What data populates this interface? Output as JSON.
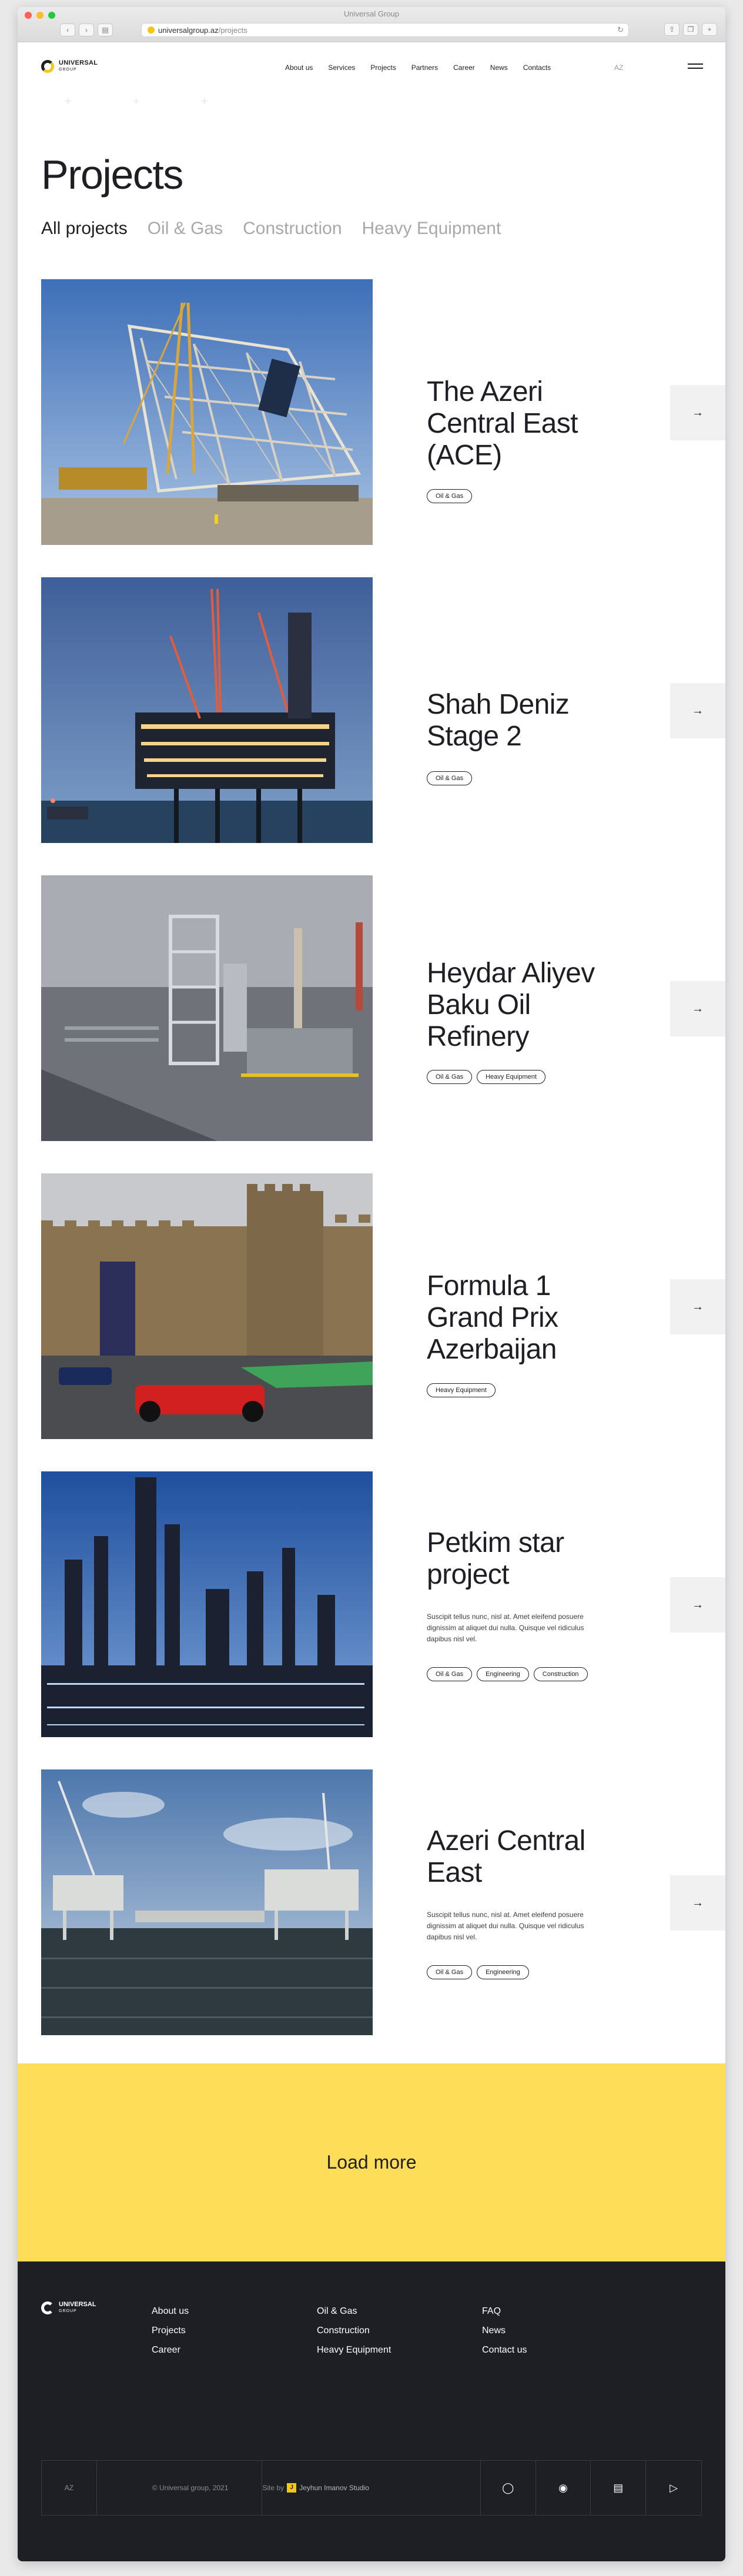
{
  "browser": {
    "window_title": "Universal Group",
    "url_domain": "universalgroup.az",
    "url_path": "/projects"
  },
  "header": {
    "logo_main": "UNIVERSAL",
    "logo_sub": "GROUP",
    "nav": [
      "About us",
      "Services",
      "Projects",
      "Partners",
      "Career",
      "News",
      "Contacts"
    ],
    "lang": "AZ"
  },
  "page": {
    "title": "Projects",
    "filters": [
      "All projects",
      "Oil & Gas",
      "Construction",
      "Heavy Equipment"
    ],
    "active_filter": "All projects"
  },
  "projects": [
    {
      "name": "The Azeri Central East (ACE)",
      "description": "",
      "tags": [
        "Oil & Gas"
      ],
      "image": "offshore-jacket-construction-yard"
    },
    {
      "name": "Shah Deniz Stage 2",
      "description": "",
      "tags": [
        "Oil & Gas"
      ],
      "image": "offshore-platform-at-dusk"
    },
    {
      "name": "Heydar Aliyev Baku Oil Refinery",
      "description": "",
      "tags": [
        "Oil & Gas",
        "Heavy Equipment"
      ],
      "image": "oil-refinery-aerial"
    },
    {
      "name": "Formula 1 Grand Prix Azerbaijan",
      "description": "",
      "tags": [
        "Heavy Equipment"
      ],
      "image": "f1-car-old-city-wall"
    },
    {
      "name": "Petkim star project",
      "description": "Suscipit tellus nunc, nisl at. Amet eleifend posuere dignissim at aliquet dui nulla. Quisque vel ridiculus dapibus nisl vel.",
      "tags": [
        "Oil & Gas",
        "Engineering",
        "Construction"
      ],
      "image": "refinery-columns-night"
    },
    {
      "name": "Azeri Central East",
      "description": "Suscipit tellus nunc, nisl at. Amet eleifend posuere dignissim at aliquet dui nulla. Quisque vel ridiculus dapibus nisl vel.",
      "tags": [
        "Oil & Gas",
        "Engineering"
      ],
      "image": "offshore-platforms-sea"
    }
  ],
  "load_more": "Load more",
  "footer": {
    "logo_main": "UNIVERSAL",
    "logo_sub": "GROUP",
    "col1": [
      "About us",
      "Projects",
      "Career"
    ],
    "col2": [
      "Oil & Gas",
      "Construction",
      "Heavy Equipment"
    ],
    "col3": [
      "FAQ",
      "News",
      "Contact us"
    ],
    "lang": "AZ",
    "copyright": "© Universal group, 2021",
    "site_by_prefix": "Site by",
    "studio_letter": "J",
    "studio_name": "Jeyhun Imanov Studio",
    "social": [
      "instagram-icon",
      "facebook-icon",
      "linkedin-icon",
      "youtube-icon"
    ]
  },
  "colors": {
    "accent": "#fedd58",
    "dark": "#1e1f24",
    "muted": "#a8a8ac"
  }
}
